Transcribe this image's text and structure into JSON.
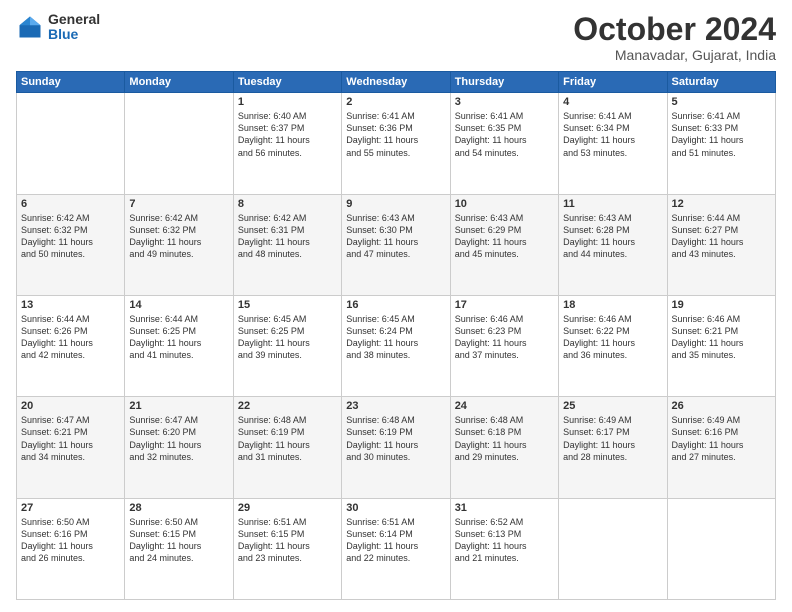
{
  "logo": {
    "general": "General",
    "blue": "Blue"
  },
  "title": {
    "month": "October 2024",
    "location": "Manavadar, Gujarat, India"
  },
  "days_header": [
    "Sunday",
    "Monday",
    "Tuesday",
    "Wednesday",
    "Thursday",
    "Friday",
    "Saturday"
  ],
  "weeks": [
    [
      {
        "day": "",
        "info": ""
      },
      {
        "day": "",
        "info": ""
      },
      {
        "day": "1",
        "info": "Sunrise: 6:40 AM\nSunset: 6:37 PM\nDaylight: 11 hours\nand 56 minutes."
      },
      {
        "day": "2",
        "info": "Sunrise: 6:41 AM\nSunset: 6:36 PM\nDaylight: 11 hours\nand 55 minutes."
      },
      {
        "day": "3",
        "info": "Sunrise: 6:41 AM\nSunset: 6:35 PM\nDaylight: 11 hours\nand 54 minutes."
      },
      {
        "day": "4",
        "info": "Sunrise: 6:41 AM\nSunset: 6:34 PM\nDaylight: 11 hours\nand 53 minutes."
      },
      {
        "day": "5",
        "info": "Sunrise: 6:41 AM\nSunset: 6:33 PM\nDaylight: 11 hours\nand 51 minutes."
      }
    ],
    [
      {
        "day": "6",
        "info": "Sunrise: 6:42 AM\nSunset: 6:32 PM\nDaylight: 11 hours\nand 50 minutes."
      },
      {
        "day": "7",
        "info": "Sunrise: 6:42 AM\nSunset: 6:32 PM\nDaylight: 11 hours\nand 49 minutes."
      },
      {
        "day": "8",
        "info": "Sunrise: 6:42 AM\nSunset: 6:31 PM\nDaylight: 11 hours\nand 48 minutes."
      },
      {
        "day": "9",
        "info": "Sunrise: 6:43 AM\nSunset: 6:30 PM\nDaylight: 11 hours\nand 47 minutes."
      },
      {
        "day": "10",
        "info": "Sunrise: 6:43 AM\nSunset: 6:29 PM\nDaylight: 11 hours\nand 45 minutes."
      },
      {
        "day": "11",
        "info": "Sunrise: 6:43 AM\nSunset: 6:28 PM\nDaylight: 11 hours\nand 44 minutes."
      },
      {
        "day": "12",
        "info": "Sunrise: 6:44 AM\nSunset: 6:27 PM\nDaylight: 11 hours\nand 43 minutes."
      }
    ],
    [
      {
        "day": "13",
        "info": "Sunrise: 6:44 AM\nSunset: 6:26 PM\nDaylight: 11 hours\nand 42 minutes."
      },
      {
        "day": "14",
        "info": "Sunrise: 6:44 AM\nSunset: 6:25 PM\nDaylight: 11 hours\nand 41 minutes."
      },
      {
        "day": "15",
        "info": "Sunrise: 6:45 AM\nSunset: 6:25 PM\nDaylight: 11 hours\nand 39 minutes."
      },
      {
        "day": "16",
        "info": "Sunrise: 6:45 AM\nSunset: 6:24 PM\nDaylight: 11 hours\nand 38 minutes."
      },
      {
        "day": "17",
        "info": "Sunrise: 6:46 AM\nSunset: 6:23 PM\nDaylight: 11 hours\nand 37 minutes."
      },
      {
        "day": "18",
        "info": "Sunrise: 6:46 AM\nSunset: 6:22 PM\nDaylight: 11 hours\nand 36 minutes."
      },
      {
        "day": "19",
        "info": "Sunrise: 6:46 AM\nSunset: 6:21 PM\nDaylight: 11 hours\nand 35 minutes."
      }
    ],
    [
      {
        "day": "20",
        "info": "Sunrise: 6:47 AM\nSunset: 6:21 PM\nDaylight: 11 hours\nand 34 minutes."
      },
      {
        "day": "21",
        "info": "Sunrise: 6:47 AM\nSunset: 6:20 PM\nDaylight: 11 hours\nand 32 minutes."
      },
      {
        "day": "22",
        "info": "Sunrise: 6:48 AM\nSunset: 6:19 PM\nDaylight: 11 hours\nand 31 minutes."
      },
      {
        "day": "23",
        "info": "Sunrise: 6:48 AM\nSunset: 6:19 PM\nDaylight: 11 hours\nand 30 minutes."
      },
      {
        "day": "24",
        "info": "Sunrise: 6:48 AM\nSunset: 6:18 PM\nDaylight: 11 hours\nand 29 minutes."
      },
      {
        "day": "25",
        "info": "Sunrise: 6:49 AM\nSunset: 6:17 PM\nDaylight: 11 hours\nand 28 minutes."
      },
      {
        "day": "26",
        "info": "Sunrise: 6:49 AM\nSunset: 6:16 PM\nDaylight: 11 hours\nand 27 minutes."
      }
    ],
    [
      {
        "day": "27",
        "info": "Sunrise: 6:50 AM\nSunset: 6:16 PM\nDaylight: 11 hours\nand 26 minutes."
      },
      {
        "day": "28",
        "info": "Sunrise: 6:50 AM\nSunset: 6:15 PM\nDaylight: 11 hours\nand 24 minutes."
      },
      {
        "day": "29",
        "info": "Sunrise: 6:51 AM\nSunset: 6:15 PM\nDaylight: 11 hours\nand 23 minutes."
      },
      {
        "day": "30",
        "info": "Sunrise: 6:51 AM\nSunset: 6:14 PM\nDaylight: 11 hours\nand 22 minutes."
      },
      {
        "day": "31",
        "info": "Sunrise: 6:52 AM\nSunset: 6:13 PM\nDaylight: 11 hours\nand 21 minutes."
      },
      {
        "day": "",
        "info": ""
      },
      {
        "day": "",
        "info": ""
      }
    ]
  ]
}
